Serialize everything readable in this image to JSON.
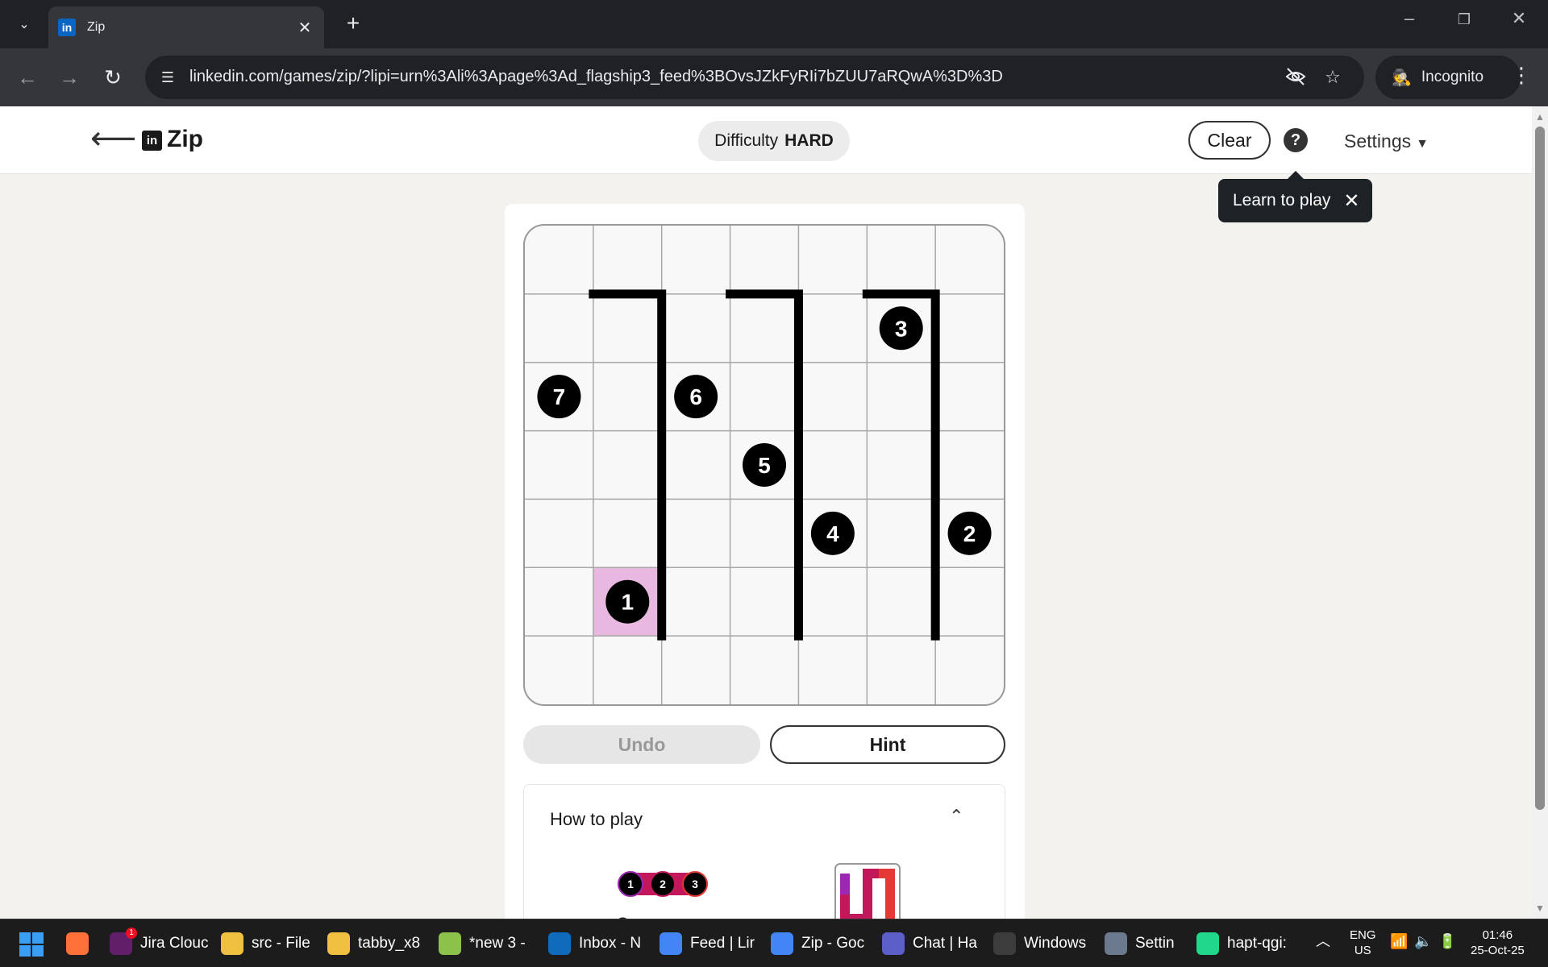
{
  "browser": {
    "tab_title": "Zip",
    "tab_favicon_text": "in",
    "url": "linkedin.com/games/zip/?lipi=urn%3Ali%3Apage%3Ad_flagship3_feed%3BOvsJZkFyRIi7bZUU7aRQwA%3D%3D",
    "incognito_label": "Incognito"
  },
  "header": {
    "logo_text": "in",
    "title": "Zip",
    "difficulty_label": "Difficulty",
    "difficulty_value": "HARD",
    "clear_label": "Clear",
    "help_symbol": "?",
    "settings_label": "Settings"
  },
  "tooltip": {
    "text": "Learn to play"
  },
  "board": {
    "grid_size": 7,
    "numbers": [
      {
        "n": "1",
        "row": 5,
        "col": 1
      },
      {
        "n": "2",
        "row": 4,
        "col": 6
      },
      {
        "n": "3",
        "row": 1,
        "col": 5
      },
      {
        "n": "4",
        "row": 4,
        "col": 4
      },
      {
        "n": "5",
        "row": 3,
        "col": 3
      },
      {
        "n": "6",
        "row": 2,
        "col": 2
      },
      {
        "n": "7",
        "row": 2,
        "col": 0
      }
    ],
    "highlighted_cell": {
      "row": 5,
      "col": 1
    },
    "walls": [
      {
        "top_row": 1,
        "left_col": 1,
        "right_col": 2,
        "bottom_row": 6
      },
      {
        "top_row": 1,
        "left_col": 3,
        "right_col": 4,
        "bottom_row": 6
      },
      {
        "top_row": 1,
        "left_col": 5,
        "right_col": 6,
        "bottom_row": 6
      }
    ],
    "highlight_color": "#e8b8e0",
    "wall_color": "#000000"
  },
  "controls": {
    "undo_label": "Undo",
    "hint_label": "Hint"
  },
  "how_to_play": {
    "title": "How to play",
    "example_numbers": [
      "1",
      "2",
      "3"
    ],
    "caption_fragment": "C"
  },
  "taskbar": {
    "items": [
      {
        "label": "",
        "icon": "firefox-icon",
        "color": "#ff7139"
      },
      {
        "label": "Jira Clouc",
        "icon": "slack-icon",
        "color": "#611f69",
        "badge": "1"
      },
      {
        "label": "src - File",
        "icon": "folder-icon",
        "color": "#f0c040"
      },
      {
        "label": "tabby_x8",
        "icon": "folder-icon",
        "color": "#f0c040"
      },
      {
        "label": "*new 3 -",
        "icon": "notepad-icon",
        "color": "#8bc34a"
      },
      {
        "label": "Inbox - N",
        "icon": "outlook-icon",
        "color": "#0f6cbd"
      },
      {
        "label": "Feed | Lir",
        "icon": "chrome-icon",
        "color": "#4285f4"
      },
      {
        "label": "Zip - Goc",
        "icon": "chrome-icon",
        "color": "#4285f4"
      },
      {
        "label": "Chat | Ha",
        "icon": "teams-icon",
        "color": "#5b5fc7"
      },
      {
        "label": "Windows",
        "icon": "terminal-icon",
        "color": "#3c3c3c"
      },
      {
        "label": "Settin",
        "icon": "settings-icon",
        "color": "#6b7a8f"
      },
      {
        "label": "hapt-qgi:",
        "icon": "pycharm-icon",
        "color": "#21d789"
      }
    ],
    "lang_line1": "ENG",
    "lang_line2": "US",
    "time": "01:46",
    "date": "25-Oct-25"
  }
}
